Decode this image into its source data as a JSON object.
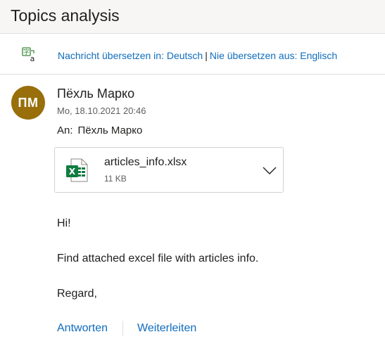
{
  "header": {
    "title": "Topics analysis"
  },
  "translate": {
    "icon": "translate-icon",
    "translate_link": "Nachricht übersetzen in: Deutsch",
    "separator": "|",
    "never_link": "Nie übersetzen aus: Englisch"
  },
  "message": {
    "avatar_initials": "ПМ",
    "avatar_color": "#986f0b",
    "sender": "Пёхль Марко",
    "date": "Mo, 18.10.2021 20:46",
    "to_label": "An:",
    "to_value": "Пёхль Марко"
  },
  "attachment": {
    "icon": "excel-file-icon",
    "name": "articles_info.xlsx",
    "size": "11 KB"
  },
  "body": {
    "greeting": "Hi!",
    "line": "Find attached excel file with articles info.",
    "closing": "Regard,"
  },
  "actions": {
    "reply": "Antworten",
    "forward": "Weiterleiten"
  },
  "colors": {
    "accent": "#0f6cbd",
    "excel_green": "#107c41"
  }
}
